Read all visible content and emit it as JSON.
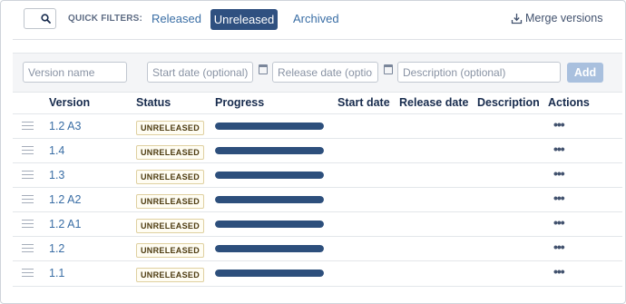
{
  "filters": {
    "label": "QUICK FILTERS:",
    "options": [
      "Released",
      "Unreleased",
      "Archived"
    ],
    "active": "Unreleased"
  },
  "merge_label": "Merge versions",
  "form": {
    "version_name_placeholder": "Version name",
    "start_date_placeholder": "Start date (optional)",
    "release_date_placeholder": "Release date (optional)",
    "description_placeholder": "Description (optional)",
    "add_label": "Add"
  },
  "columns": {
    "version": "Version",
    "status": "Status",
    "progress": "Progress",
    "start_date": "Start date",
    "release_date": "Release date",
    "description": "Description",
    "actions": "Actions"
  },
  "versions": [
    {
      "name": "1.2 A3",
      "status": "UNRELEASED",
      "progress": 1,
      "start_date": "",
      "release_date": "",
      "description": ""
    },
    {
      "name": "1.4",
      "status": "UNRELEASED",
      "progress": 1,
      "start_date": "",
      "release_date": "",
      "description": ""
    },
    {
      "name": "1.3",
      "status": "UNRELEASED",
      "progress": 1,
      "start_date": "",
      "release_date": "",
      "description": ""
    },
    {
      "name": "1.2 A2",
      "status": "UNRELEASED",
      "progress": 1,
      "start_date": "",
      "release_date": "",
      "description": ""
    },
    {
      "name": "1.2 A1",
      "status": "UNRELEASED",
      "progress": 1,
      "start_date": "",
      "release_date": "",
      "description": ""
    },
    {
      "name": "1.2",
      "status": "UNRELEASED",
      "progress": 1,
      "start_date": "",
      "release_date": "",
      "description": ""
    },
    {
      "name": "1.1",
      "status": "UNRELEASED",
      "progress": 1,
      "start_date": "",
      "release_date": "",
      "description": ""
    }
  ],
  "actions_glyph": "•••",
  "colors": {
    "link": "#3a6ea5",
    "active_filter_bg": "#2f5080",
    "progress_fill": "#2d4f7c",
    "add_button_disabled": "#a9c0de"
  }
}
